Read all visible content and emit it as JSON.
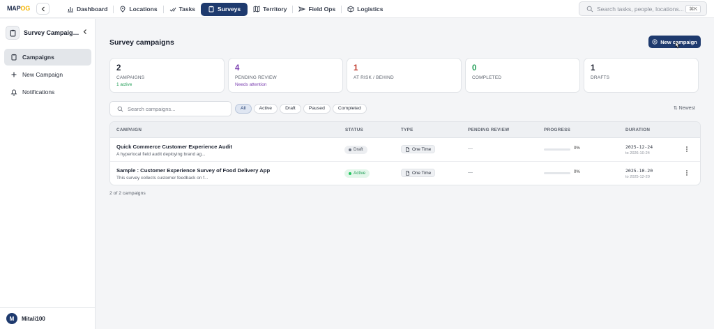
{
  "app": {
    "logo_a": "MAP",
    "logo_b": "OG"
  },
  "nav": {
    "items": [
      {
        "label": "Dashboard",
        "icon": "bar-chart-icon"
      },
      {
        "label": "Locations",
        "icon": "location-pin-icon"
      },
      {
        "label": "Tasks",
        "icon": "tasks-check-icon"
      },
      {
        "label": "Surveys",
        "icon": "clipboard-icon",
        "active": true
      },
      {
        "label": "Territory",
        "icon": "map-icon"
      },
      {
        "label": "Field Ops",
        "icon": "send-icon"
      },
      {
        "label": "Logistics",
        "icon": "box-icon"
      }
    ]
  },
  "search": {
    "placeholder": "Search tasks, people, locations...",
    "shortcut": "⌘K"
  },
  "sidebar": {
    "title": "Survey Campaigns",
    "items": [
      {
        "label": "Campaigns",
        "icon": "clipboard-icon",
        "active": true
      },
      {
        "label": "New Campaign",
        "icon": "plus-icon"
      },
      {
        "label": "Notifications",
        "icon": "bell-icon"
      }
    ],
    "user": {
      "initial": "M",
      "name": "Mitali100"
    }
  },
  "page": {
    "title": "Survey campaigns",
    "new_button": "New campaign"
  },
  "stats": [
    {
      "value": "2",
      "label": "CAMPAIGNS",
      "sub": "1 active",
      "color": "#1c2230",
      "sub_color": "#1f9d55"
    },
    {
      "value": "4",
      "label": "PENDING REVIEW",
      "sub": "Needs attention",
      "color": "#7b3fb0",
      "sub_color": "#7b3fb0"
    },
    {
      "value": "1",
      "label": "AT RISK / BEHIND",
      "sub": "",
      "color": "#c0392b",
      "sub_color": "#c0392b"
    },
    {
      "value": "0",
      "label": "COMPLETED",
      "sub": "",
      "color": "#1f9d55",
      "sub_color": "#1f9d55"
    },
    {
      "value": "1",
      "label": "DRAFTS",
      "sub": "",
      "color": "#1c2230",
      "sub_color": "#1c2230"
    }
  ],
  "filters": {
    "search_placeholder": "Search campaigns...",
    "chips": [
      "All",
      "Active",
      "Draft",
      "Paused",
      "Completed"
    ],
    "active_chip": "All",
    "sort": "⇅ Newest"
  },
  "table": {
    "headers": [
      "CAMPAIGN",
      "STATUS",
      "TYPE",
      "PENDING REVIEW",
      "PROGRESS",
      "DURATION"
    ],
    "rows": [
      {
        "name": "Quick Commerce Customer Experience Audit",
        "description": "A hyperlocal field audit deploying brand ag...",
        "status": "Draft",
        "status_bg": "#eceef1",
        "status_fg": "#4a505b",
        "status_dot": "#6b7280",
        "type": "One Time",
        "pending": "—",
        "progress": 0,
        "progress_label": "0%",
        "start": "2025-12-24",
        "end": "to 2026-10-24"
      },
      {
        "name": "Sample : Customer Experience Survey of Food Delivery App",
        "description": "This survey collects customer feedback on f...",
        "status": "Active",
        "status_bg": "#e3f6ea",
        "status_fg": "#1f9d55",
        "status_dot": "#22c55e",
        "type": "One Time",
        "pending": "—",
        "progress": 0,
        "progress_label": "0%",
        "start": "2025-10-20",
        "end": "to 2025-12-20"
      }
    ],
    "count": "2 of 2 campaigns"
  }
}
